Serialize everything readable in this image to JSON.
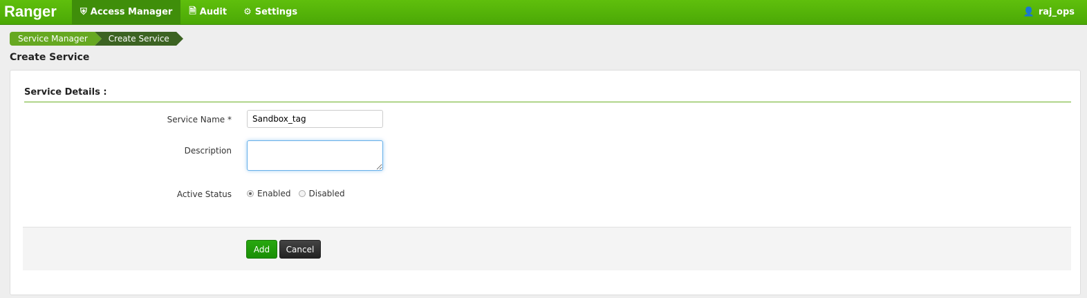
{
  "nav": {
    "brand": "Ranger",
    "items": [
      {
        "label": "Access Manager",
        "icon": "shield-icon",
        "active": true
      },
      {
        "label": "Audit",
        "icon": "file-icon"
      },
      {
        "label": "Settings",
        "icon": "gear-icon"
      }
    ],
    "user": "raj_ops",
    "color": "#4ba806"
  },
  "breadcrumb": [
    "Service Manager",
    "Create Service"
  ],
  "page_title": "Create Service",
  "form": {
    "section": "Service Details :",
    "service_name_label": "Service Name *",
    "service_name_value": "Sandbox_tag",
    "description_label": "Description",
    "description_value": "",
    "active_status_label": "Active Status",
    "enabled_label": "Enabled",
    "disabled_label": "Disabled",
    "selected": "Enabled"
  },
  "buttons": {
    "add": "Add",
    "cancel": "Cancel"
  }
}
